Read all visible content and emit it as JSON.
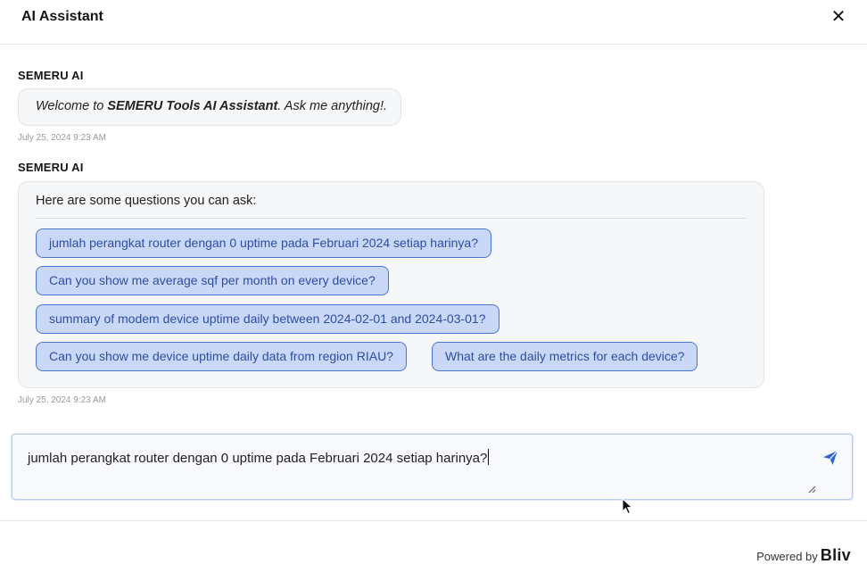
{
  "header": {
    "title": "AI Assistant",
    "close_symbol": "✕"
  },
  "messages": [
    {
      "sender": "SEMERU AI",
      "text_pre": "Welcome to ",
      "text_bold": "SEMERU Tools AI Assistant",
      "text_post": ". Ask me anything!.",
      "timestamp": "July 25, 2024 9:23 AM"
    },
    {
      "sender": "SEMERU AI",
      "intro": "Here are some questions you can ask:",
      "suggestions": [
        "jumlah perangkat router dengan 0 uptime pada Februari 2024 setiap harinya?",
        "Can you show me average sqf per month on every device?",
        "summary of modem device uptime daily between 2024-02-01 and 2024-03-01?",
        "Can you show me device uptime daily data from region RIAU?",
        "What are the daily metrics for each device?"
      ],
      "timestamp": "July 25, 2024 9:23 AM"
    }
  ],
  "input": {
    "value": "jumlah perangkat router dengan 0 uptime pada Februari 2024 setiap harinya?"
  },
  "footer": {
    "powered_by": "Powered by",
    "brand": "Bliv"
  },
  "colors": {
    "accent": "#2f63d6",
    "chip_bg": "#c9d8f7",
    "chip_border": "#4a74d6",
    "chip_text": "#2f4da6"
  }
}
